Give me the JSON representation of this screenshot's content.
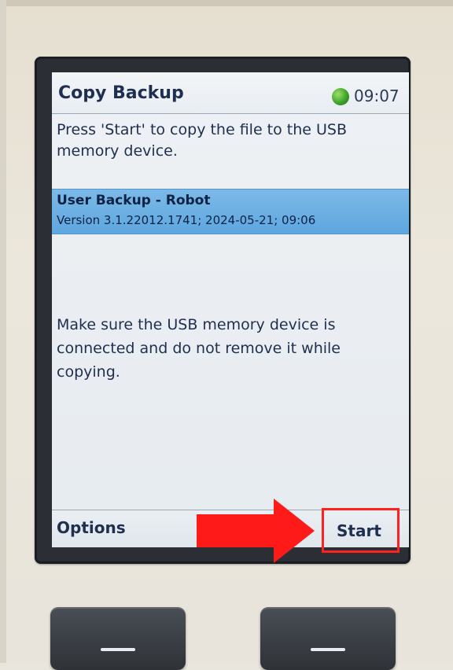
{
  "screen": {
    "title": "Copy Backup",
    "clock": "09:07",
    "instruction": "Press 'Start' to copy the file to the USB memory device.",
    "selected_item": {
      "title": "User Backup - Robot",
      "subtitle": "Version 3.1.22012.1741;  2024-05-21;  09:06"
    },
    "warning": "Make sure the USB memory device is connected and do not remove it while copying.",
    "softkeys": {
      "left": "Options",
      "right": "Start"
    }
  },
  "icons": {
    "status": "status-led-icon",
    "annotation_arrow": "red-arrow-icon",
    "key_dash": "dash-icon"
  },
  "colors": {
    "status_led": "#3fa32a",
    "selection": "#6aaee2",
    "annotation": "#ff2020",
    "title_text": "#1e2f4f"
  }
}
